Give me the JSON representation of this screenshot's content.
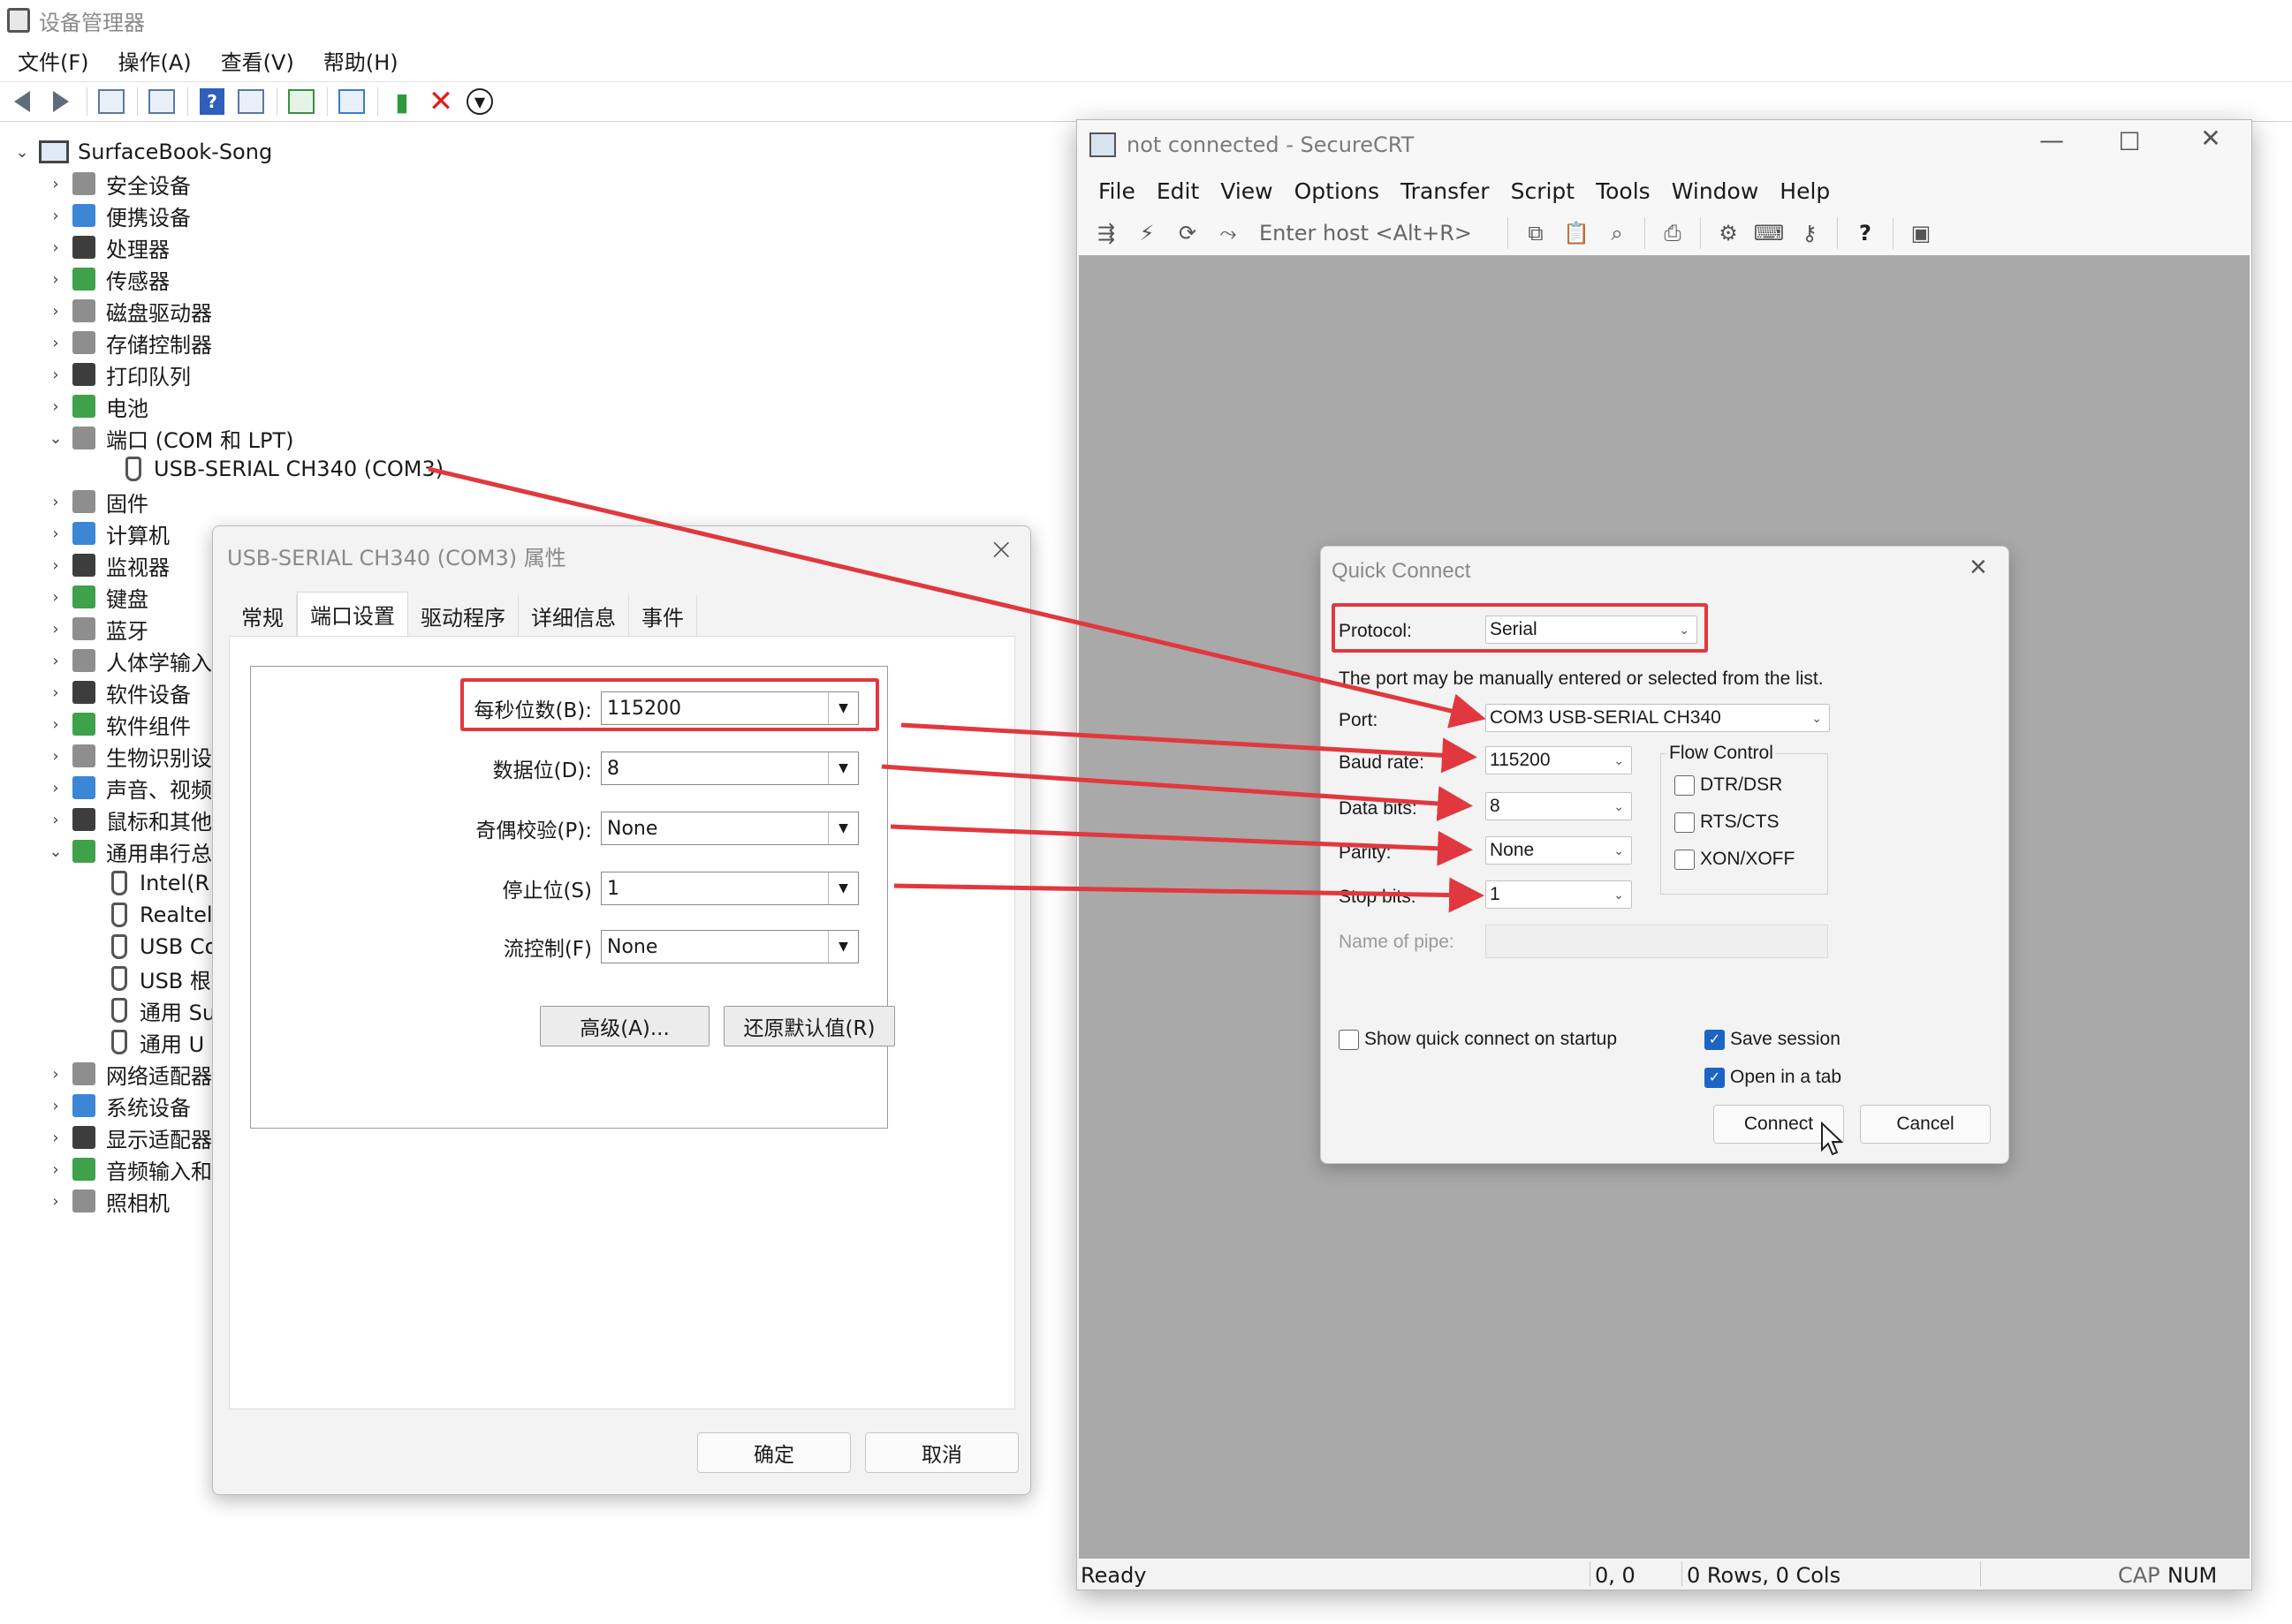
{
  "device_manager": {
    "title": "设备管理器",
    "menu": [
      "文件(F)",
      "操作(A)",
      "查看(V)",
      "帮助(H)"
    ],
    "tree": {
      "root": "SurfaceBook-Song",
      "categories": [
        "安全设备",
        "便携设备",
        "处理器",
        "传感器",
        "磁盘驱动器",
        "存储控制器",
        "打印队列",
        "电池",
        "端口 (COM 和 LPT)"
      ],
      "port_child": "USB-SERIAL CH340 (COM3)",
      "categories_2": [
        "固件",
        "计算机",
        "监视器",
        "键盘",
        "蓝牙",
        "人体学输入",
        "软件设备",
        "软件组件",
        "生物识别设",
        "声音、视频",
        "鼠标和其他",
        "通用串行总"
      ],
      "usb_children": [
        "Intel(R",
        "Realtel",
        "USB Co",
        "USB 根",
        "通用 Su",
        "通用 U"
      ],
      "categories_3": [
        "网络适配器",
        "系统设备",
        "显示适配器",
        "音频输入和",
        "照相机"
      ]
    }
  },
  "properties": {
    "title": "USB-SERIAL CH340 (COM3) 属性",
    "tabs": [
      "常规",
      "端口设置",
      "驱动程序",
      "详细信息",
      "事件"
    ],
    "active_tab": "端口设置",
    "fields": [
      {
        "label": "每秒位数(B):",
        "value": "115200"
      },
      {
        "label": "数据位(D):",
        "value": "8"
      },
      {
        "label": "奇偶校验(P):",
        "value": "None"
      },
      {
        "label": "停止位(S)",
        "value": "1"
      },
      {
        "label": "流控制(F)",
        "value": "None"
      }
    ],
    "advanced_button": "高级(A)...",
    "restore_button": "还原默认值(R)",
    "ok_button": "确定",
    "cancel_button": "取消"
  },
  "securecrt": {
    "title": "not connected - SecureCRT",
    "menu": [
      "File",
      "Edit",
      "View",
      "Options",
      "Transfer",
      "Script",
      "Tools",
      "Window",
      "Help"
    ],
    "host_placeholder": "Enter host <Alt+R>",
    "status": {
      "ready": "Ready",
      "position": "0, 0",
      "size": "0 Rows, 0 Cols",
      "cap": "CAP",
      "num": "NUM"
    }
  },
  "quick_connect": {
    "title": "Quick Connect",
    "protocol_label": "Protocol:",
    "protocol_value": "Serial",
    "hint": "The port may be manually entered or selected from the list.",
    "port_label": "Port:",
    "port_value": "COM3 USB-SERIAL CH340",
    "baud_label": "Baud rate:",
    "baud_value": "115200",
    "data_bits_label": "Data bits:",
    "data_bits_value": "8",
    "parity_label": "Parity:",
    "parity_value": "None",
    "stop_bits_label": "Stop bits:",
    "stop_bits_value": "1",
    "pipe_label": "Name of pipe:",
    "flow_control_title": "Flow Control",
    "flow_dtr": "DTR/DSR",
    "flow_rts": "RTS/CTS",
    "flow_xon": "XON/XOFF",
    "show_on_startup": "Show quick connect on startup",
    "save_session": "Save session",
    "open_in_tab": "Open in a tab",
    "connect_button": "Connect",
    "cancel_button": "Cancel"
  },
  "colors": {
    "highlight": "#e0383e",
    "checkbox_on": "#1d64c4",
    "terminal_bg": "#a9a9a9"
  }
}
